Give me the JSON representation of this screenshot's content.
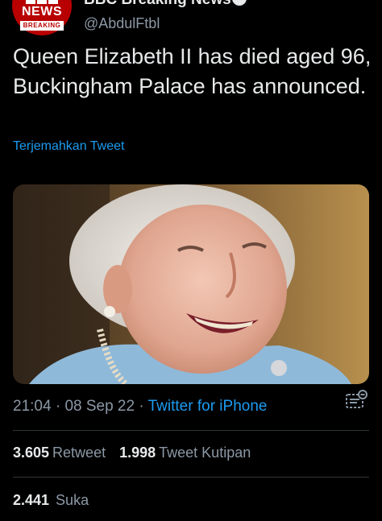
{
  "author": {
    "display_name": "BBC Breaking News",
    "handle": "@AbdulFtbl",
    "avatar_logo_main": "NEWS",
    "avatar_logo_sub": "BREAKING"
  },
  "tweet": {
    "text": "Queen Elizabeth II has died aged 96, Buckingham Palace has announced.",
    "translate_label": "Terjemahkan Tweet",
    "time": "21:04",
    "date": "08 Sep 22",
    "source": "Twitter for iPhone"
  },
  "stats": {
    "retweets": "3.605",
    "retweets_label": "Retweet",
    "quotes": "1.998",
    "quotes_label": "Tweet Kutipan",
    "likes": "2.441",
    "likes_label": "Suka"
  },
  "icons": {
    "verified": "verified-badge-icon",
    "more": "more-options-icon",
    "analytics": "tweet-analytics-icon"
  },
  "colors": {
    "background": "#000000",
    "text": "#e7e9ea",
    "secondary": "#8b98a5",
    "link": "#1d9bf0",
    "bbc_red": "#b80000"
  }
}
